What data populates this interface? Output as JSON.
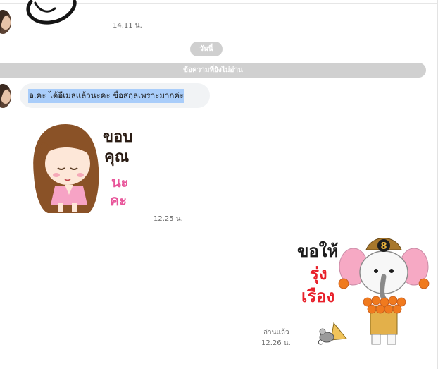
{
  "messages": {
    "first_time": "14.11 น.",
    "date_separator": "วันนี้",
    "unread_label": "ข้อความที่ยังไม่อ่าน",
    "text_message": "อ.คะ ได้อีเมลแล้วนะคะ ชื่อสกุลเพราะมากค่ะ",
    "sticker1_time": "12.25 น.",
    "sticker2_read": "อ่านแล้ว",
    "sticker2_time": "12.26 น."
  },
  "stickers": {
    "girl": {
      "lines": [
        "ขอบ",
        "คุณ",
        "นะ",
        "คะ"
      ]
    },
    "ganesha": {
      "lines": [
        "ขอให้",
        "รุ่ง",
        "เรือง"
      ],
      "badge": "8"
    }
  },
  "colors": {
    "bubble": "#f1f3f5",
    "highlight": "#a9cdfa",
    "separator": "#d0d0d0",
    "pink_text": "#e8559a",
    "red_text": "#e8202a"
  }
}
